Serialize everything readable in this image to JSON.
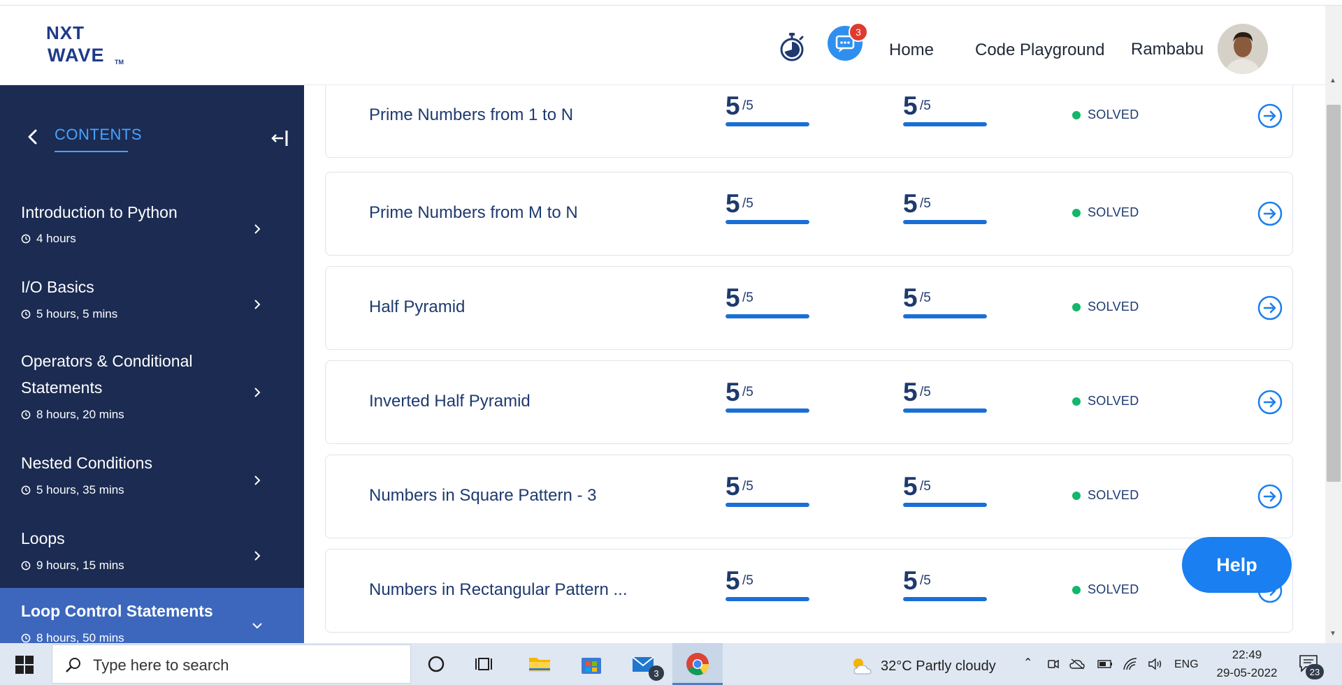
{
  "header": {
    "logo_line1": "NXT",
    "logo_line2": "WAVE",
    "logo_tm": "TM",
    "notifications_count": "3",
    "nav_home": "Home",
    "nav_playground": "Code Playground",
    "user_name": "Rambabu"
  },
  "sidebar": {
    "contents_label": "CONTENTS",
    "modules": [
      {
        "title": "Introduction to Python",
        "duration": "4 hours"
      },
      {
        "title": "I/O Basics",
        "duration": "5 hours, 5 mins"
      },
      {
        "title": "Operators & Conditional Statements",
        "duration": "8 hours, 20 mins"
      },
      {
        "title": "Nested Conditions",
        "duration": "5 hours, 35 mins"
      },
      {
        "title": "Loops",
        "duration": "9 hours, 15 mins"
      },
      {
        "title": "Loop Control Statements",
        "duration": "8 hours, 50 mins"
      }
    ]
  },
  "problems": [
    {
      "title": "Prime Numbers from 1 to N",
      "score1": "5",
      "max1": "/5",
      "score2": "5",
      "max2": "/5",
      "progress1": 1.0,
      "progress2": 1.0,
      "status": "SOLVED"
    },
    {
      "title": "Prime Numbers from M to N",
      "score1": "5",
      "max1": "/5",
      "score2": "5",
      "max2": "/5",
      "progress1": 1.0,
      "progress2": 1.0,
      "status": "SOLVED"
    },
    {
      "title": "Half Pyramid",
      "score1": "5",
      "max1": "/5",
      "score2": "5",
      "max2": "/5",
      "progress1": 1.0,
      "progress2": 1.0,
      "status": "SOLVED"
    },
    {
      "title": "Inverted Half Pyramid",
      "score1": "5",
      "max1": "/5",
      "score2": "5",
      "max2": "/5",
      "progress1": 1.0,
      "progress2": 1.0,
      "status": "SOLVED"
    },
    {
      "title": "Numbers in Square Pattern - 3",
      "score1": "5",
      "max1": "/5",
      "score2": "5",
      "max2": "/5",
      "progress1": 1.0,
      "progress2": 1.0,
      "status": "SOLVED"
    },
    {
      "title": "Numbers in Rectangular Pattern ...",
      "score1": "5",
      "max1": "/5",
      "score2": "5",
      "max2": "/5",
      "progress1": 1.0,
      "progress2": 1.0,
      "status": "SOLVED"
    }
  ],
  "help_label": "Help",
  "taskbar": {
    "search_placeholder": "Type here to search",
    "mail_badge": "3",
    "weather": "32°C  Partly cloudy",
    "language": "ENG",
    "time": "22:49",
    "date": "29-05-2022",
    "notification_count": "23"
  },
  "colors": {
    "sidebar_bg": "#1b2b52",
    "sidebar_active": "#3c67bd",
    "accent": "#1a7ff0",
    "solved": "#12b76a",
    "text_dark": "#1e3a6f"
  }
}
